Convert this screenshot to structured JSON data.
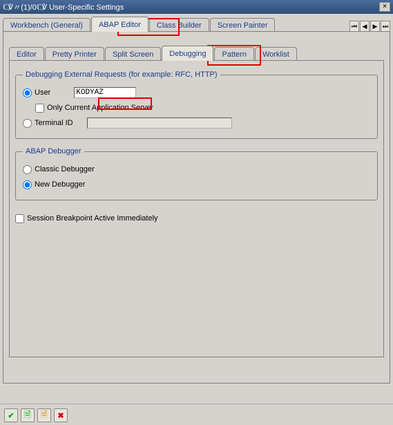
{
  "titlebar": {
    "text": "ℂ℣〃(1)/0ℂ℣ User-Specific Settings"
  },
  "main_tabs": {
    "workbench": "Workbench (General)",
    "abap_editor": "ABAP Editor",
    "class_builder": "Class Builder",
    "screen_painter": "Screen Painter"
  },
  "sub_tabs": {
    "editor": "Editor",
    "pretty_printer": "Pretty Printer",
    "split_screen": "Split Screen",
    "debugging": "Debugging",
    "pattern": "Pattern",
    "worklist": "Worklist"
  },
  "group_ext": {
    "legend": "Debugging External Requests (for example: RFC, HTTP)",
    "user_label": "User",
    "user_value": "KODYAZ",
    "only_current": "Only Current Application Server",
    "terminal_label": "Terminal ID"
  },
  "group_abap": {
    "legend": "ABAP Debugger",
    "classic": "Classic Debugger",
    "newdbg": "New Debugger"
  },
  "session_bp_label": "Session Breakpoint Active Immediately"
}
